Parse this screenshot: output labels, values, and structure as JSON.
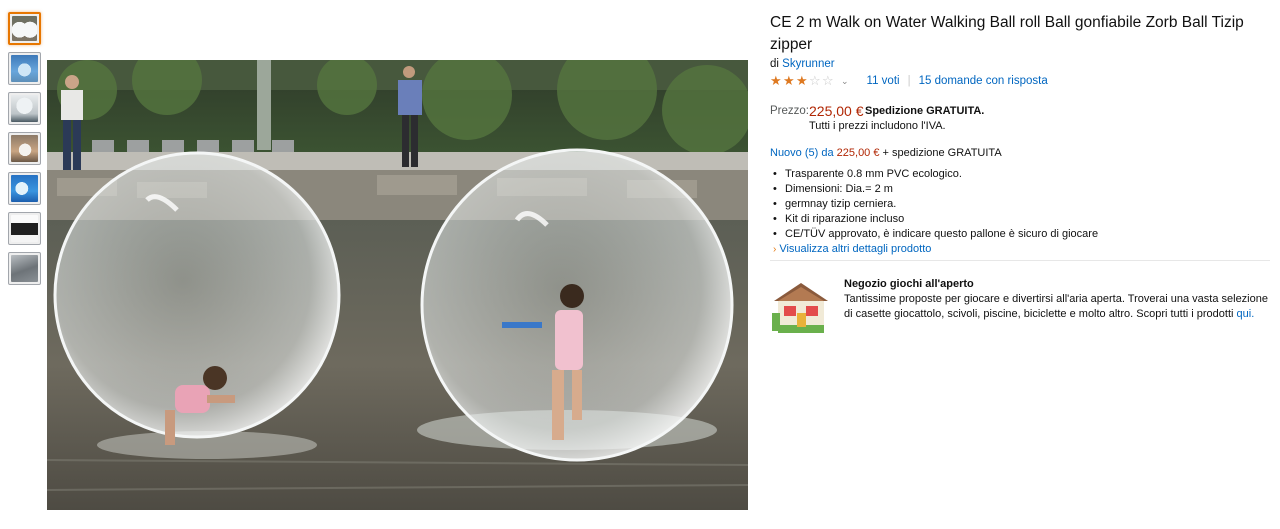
{
  "thumbnails": [
    {
      "name": "thumb-1",
      "active": true
    },
    {
      "name": "thumb-2",
      "active": false
    },
    {
      "name": "thumb-3",
      "active": false
    },
    {
      "name": "thumb-4",
      "active": false
    },
    {
      "name": "thumb-5",
      "active": false
    },
    {
      "name": "thumb-6",
      "active": false
    },
    {
      "name": "thumb-7",
      "active": false
    }
  ],
  "product": {
    "title": "CE 2 m Walk on Water Walking Ball roll Ball gonfiabile Zorb Ball Tizip zipper",
    "by_prefix": "di",
    "brand": "Skyrunner",
    "rating_stars": 3,
    "rating_max": 5,
    "votes": "11 voti",
    "questions": "15 domande con risposta"
  },
  "price": {
    "label": "Prezzo:",
    "value": "225,00 €",
    "shipping": "Spedizione GRATUITA.",
    "vat_note": "Tutti i prezzi includono l'IVA."
  },
  "offers": {
    "link_text": "Nuovo (5) da",
    "price": "225,00 €",
    "suffix": "+ spedizione GRATUITA"
  },
  "features": [
    "Trasparente 0.8 mm PVC ecologico.",
    "Dimensioni: Dia.= 2 m",
    "germnay tizip cerniera.",
    "Kit di riparazione incluso",
    "CE/TÜV approvato, è indicare questo pallone è sicuro di giocare"
  ],
  "more_details": "Visualizza altri dettagli prodotto",
  "promo": {
    "title": "Negozio giochi all'aperto",
    "text": "Tantissime proposte per giocare e divertirsi all'aria aperta. Troverai una vasta selezione di casette giocattolo, scivoli, piscine, biciclette e molto altro. Scopri tutti i prodotti",
    "link": "qui."
  },
  "colors": {
    "link": "#0066c0",
    "price": "#b12704",
    "star": "#de7921",
    "active_thumb": "#e77600"
  }
}
